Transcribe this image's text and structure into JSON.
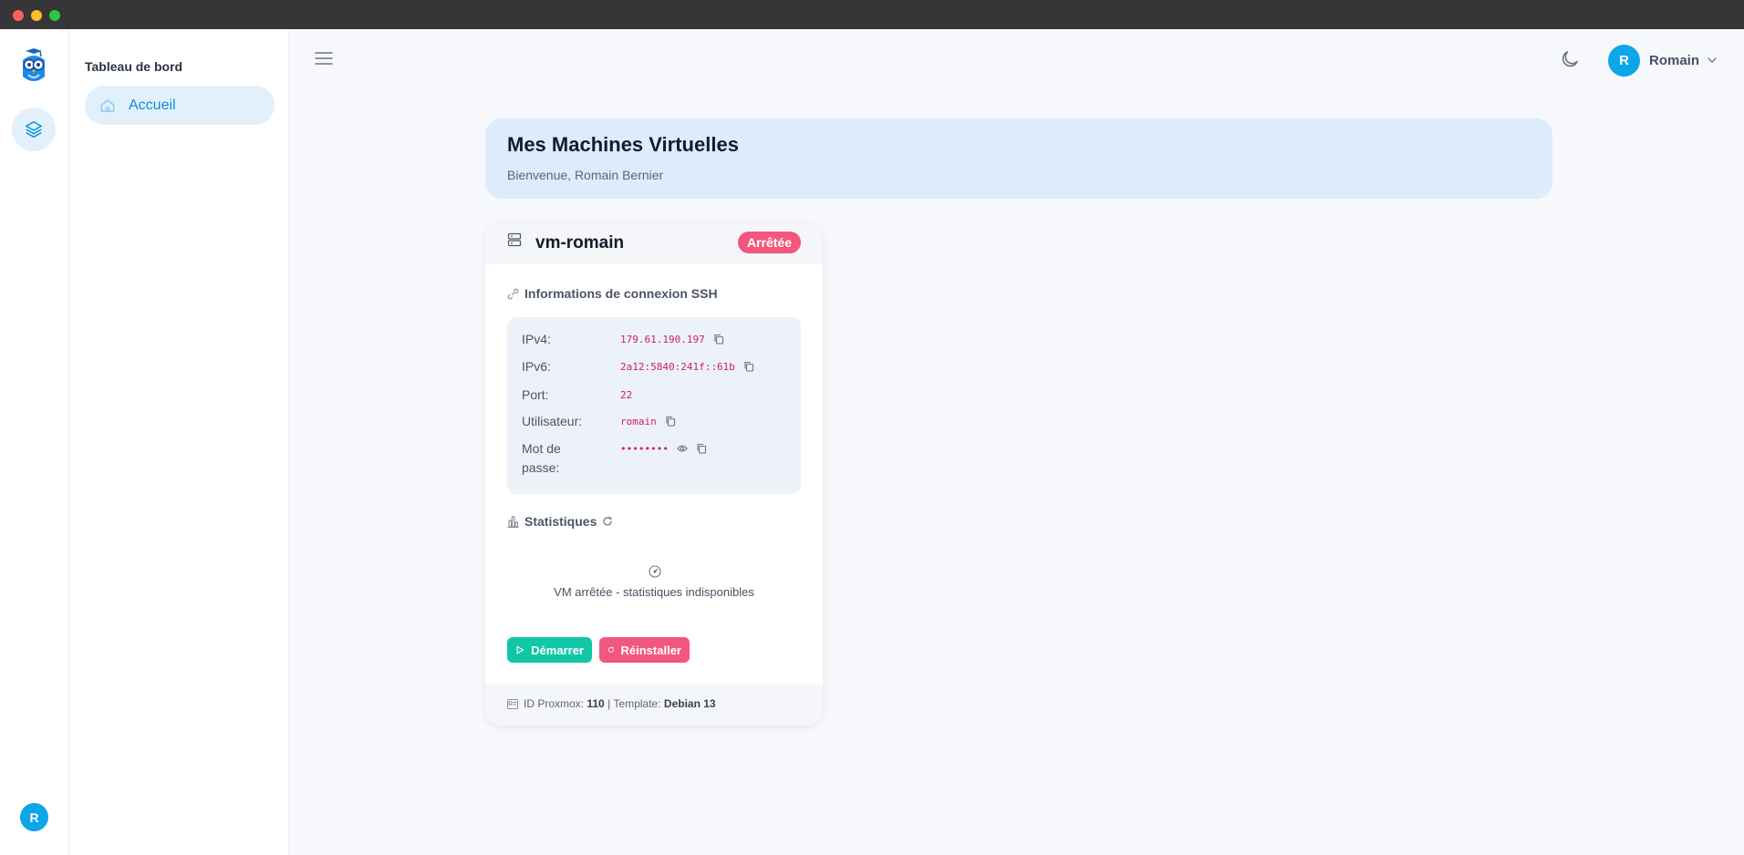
{
  "sidebar": {
    "heading": "Tableau de bord",
    "items": [
      {
        "label": "Accueil",
        "icon": "home-icon",
        "active": true
      }
    ]
  },
  "rail": {
    "avatar_initial": "R"
  },
  "header": {
    "user_initial": "R",
    "user_name": "Romain"
  },
  "hero": {
    "title": "Mes Machines Virtuelles",
    "subtitle": "Bienvenue, Romain Bernier"
  },
  "vm": {
    "name": "vm-romain",
    "status": "Arrêtée",
    "ssh_title": "Informations de connexion SSH",
    "fields": {
      "ipv4_label": "IPv4:",
      "ipv4": "179.61.190.197",
      "ipv6_label": "IPv6:",
      "ipv6": "2a12:5840:241f::61b",
      "port_label": "Port:",
      "port": "22",
      "user_label": "Utilisateur:",
      "user": "romain",
      "password_label_1": "Mot de",
      "password_label_2": "passe:",
      "password": "••••••••"
    },
    "stats_title": "Statistiques",
    "stats_empty": "VM arrêtée - statistiques indisponibles",
    "actions": {
      "start": "Démarrer",
      "reinstall": "Réinstaller"
    },
    "footer": {
      "id_label": "ID Proxmox:",
      "id": "110",
      "sep": "|",
      "template_label": "Template:",
      "template": "Debian 13"
    }
  },
  "colors": {
    "accent": "#0ea5e9",
    "danger": "#f2577d",
    "success": "#12c7a7",
    "hero_bg": "#dcecfb"
  }
}
